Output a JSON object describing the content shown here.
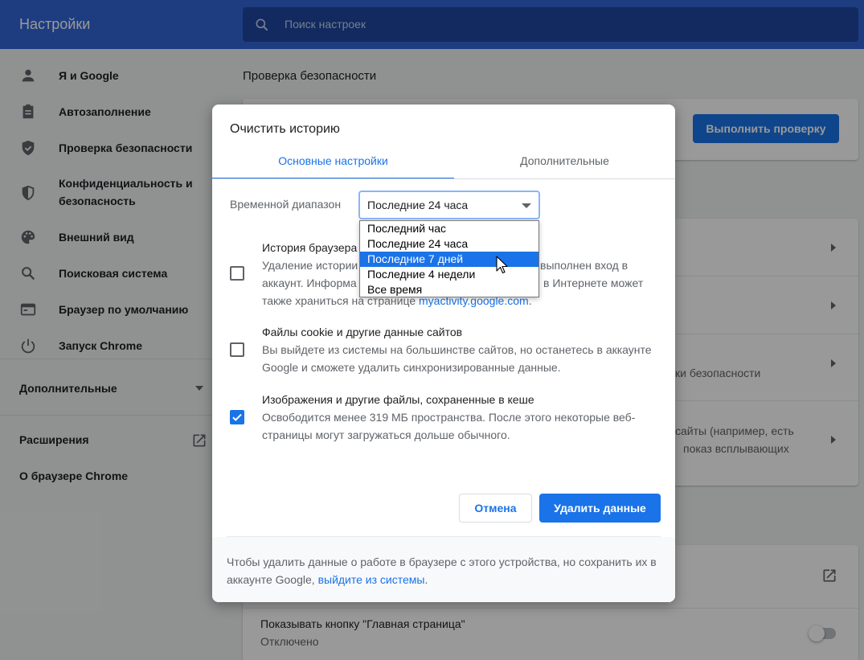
{
  "app": {
    "title": "Настройки"
  },
  "search": {
    "placeholder": "Поиск настроек"
  },
  "sidebar": {
    "items": [
      {
        "label": "Я и Google",
        "icon": "person-icon"
      },
      {
        "label": "Автозаполнение",
        "icon": "clipboard-icon"
      },
      {
        "label": "Проверка безопасности",
        "icon": "shield-icon"
      },
      {
        "label": "Конфиденциальность и безопасность",
        "label_line1": "Конфиденциальность и",
        "label_line2": "безопасность",
        "icon": "shield-half-icon"
      },
      {
        "label": "Внешний вид",
        "icon": "palette-icon"
      },
      {
        "label": "Поисковая система",
        "icon": "search-icon"
      },
      {
        "label": "Браузер по умолчанию",
        "icon": "browser-icon"
      },
      {
        "label": "Запуск Chrome",
        "icon": "power-icon"
      }
    ],
    "advanced": "Дополнительные",
    "extensions": "Расширения",
    "about": "О браузере Chrome"
  },
  "main": {
    "safety_title": "Проверка безопасности",
    "run_check": "Выполнить проверку",
    "partial_security": "ки безопасности",
    "partial_sites_1": "сайты (например, есть",
    "partial_sites_2": "показ всплывающих",
    "home_button_title": "Показывать кнопку \"Главная страница\"",
    "home_button_state": "Отключено"
  },
  "dialog": {
    "title": "Очистить историю",
    "tabs": {
      "basic": "Основные настройки",
      "advanced": "Дополнительные"
    },
    "time_range_label": "Временной диапазон",
    "time_range_value": "Последние 24 часа",
    "time_range_options": [
      "Последний час",
      "Последние 24 часа",
      "Последние 7 дней",
      "Последние 4 недели",
      "Все время"
    ],
    "time_range_highlighted": "Последние 7 дней",
    "options": [
      {
        "title": "История браузера",
        "desc_1": "Удаление истории",
        "desc_1_end": "выполнен вход в",
        "desc_2": "аккаунт. Информа",
        "desc_2_end": "в Интернете может",
        "desc_3": "также храниться на странице",
        "desc_3_link": "myactivity.google.com",
        "desc_3_end": ".",
        "checked": false
      },
      {
        "title": "Файлы cookie и другие данные сайтов",
        "desc": "Вы выйдете из системы на большинстве сайтов, но останетесь в аккаунте Google и сможете удалить синхронизированные данные.",
        "checked": false
      },
      {
        "title": "Изображения и другие файлы, сохраненные в кеше",
        "desc": "Освободится менее 319 МБ пространства. После этого некоторые веб-страницы могут загружаться дольше обычного.",
        "checked": true
      }
    ],
    "cancel": "Отмена",
    "delete": "Удалить данные",
    "footer_text": "Чтобы удалить данные о работе в браузере с этого устройства, но сохранить их в аккаунте Google,",
    "footer_link": "выйдите из системы",
    "footer_end": "."
  },
  "colors": {
    "accent": "#1a73e8",
    "topbar": "#3367d6"
  }
}
